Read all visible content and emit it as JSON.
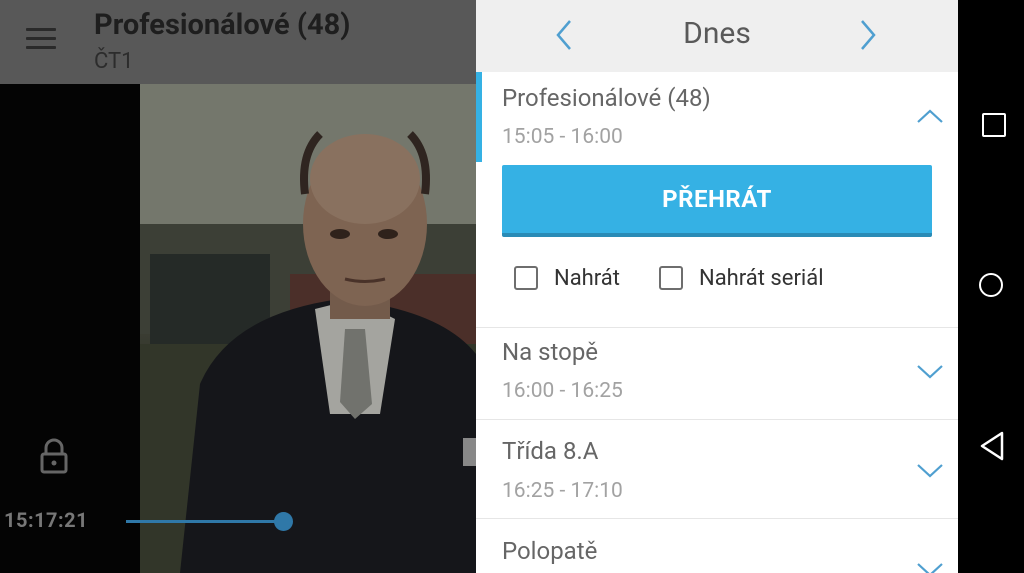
{
  "player": {
    "title": "Profesionálové (48)",
    "channel": "ČT1",
    "current_time": "15:17:21",
    "progress": 0.64
  },
  "icons": {
    "menu": "hamburger-icon",
    "lock": "lock-icon",
    "prev": "chevron-left-icon",
    "next": "chevron-right-icon",
    "expand": "chevron-down-icon",
    "collapse": "chevron-up-icon"
  },
  "epg": {
    "day_label": "Dnes",
    "programs": [
      {
        "name": "Profesionálové (48)",
        "time": "15:05 - 16:00",
        "expanded": true
      },
      {
        "name": "Na stopě",
        "time": "16:00 - 16:25",
        "expanded": false
      },
      {
        "name": "Třída 8.A",
        "time": "16:25 - 17:10",
        "expanded": false
      },
      {
        "name": "Polopatě",
        "time": "",
        "expanded": false
      }
    ],
    "play_label": "PŘEHRÁT",
    "record_label": "Nahrát",
    "record_series_label": "Nahrát seriál"
  },
  "colors": {
    "accent": "#35b1e4",
    "seek": "#2f78a8",
    "chevron": "#4f9fd0"
  }
}
